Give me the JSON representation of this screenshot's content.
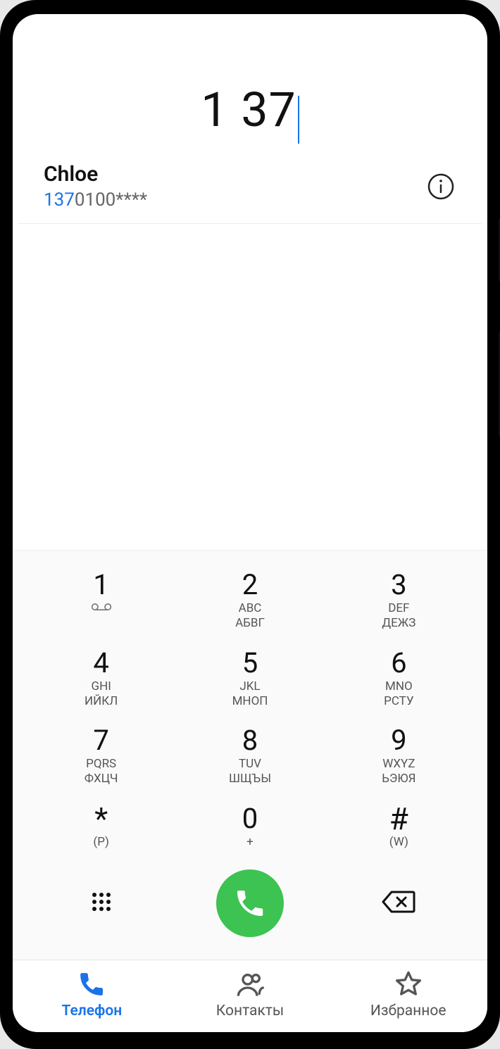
{
  "dialed_number": "1 37",
  "match": {
    "name": "Chloe",
    "highlight": "137",
    "rest": "0100****"
  },
  "keys": [
    [
      {
        "digit": "1",
        "sub": "",
        "sub2": "",
        "vm": true
      },
      {
        "digit": "2",
        "sub": "ABC",
        "sub2": "АБВГ"
      },
      {
        "digit": "3",
        "sub": "DEF",
        "sub2": "ДЕЖЗ"
      }
    ],
    [
      {
        "digit": "4",
        "sub": "GHI",
        "sub2": "ИЙКЛ"
      },
      {
        "digit": "5",
        "sub": "JKL",
        "sub2": "МНОП"
      },
      {
        "digit": "6",
        "sub": "MNO",
        "sub2": "РСТУ"
      }
    ],
    [
      {
        "digit": "7",
        "sub": "PQRS",
        "sub2": "ФХЦЧ"
      },
      {
        "digit": "8",
        "sub": "TUV",
        "sub2": "ШЩЪЫ"
      },
      {
        "digit": "9",
        "sub": "WXYZ",
        "sub2": "ЬЭЮЯ"
      }
    ],
    [
      {
        "digit": "*",
        "sub": "(P)",
        "sub2": ""
      },
      {
        "digit": "0",
        "sub": "+",
        "sub2": ""
      },
      {
        "digit": "#",
        "sub": "(W)",
        "sub2": ""
      }
    ]
  ],
  "tabs": {
    "phone": "Телефон",
    "contacts": "Контакты",
    "favorites": "Избранное"
  }
}
